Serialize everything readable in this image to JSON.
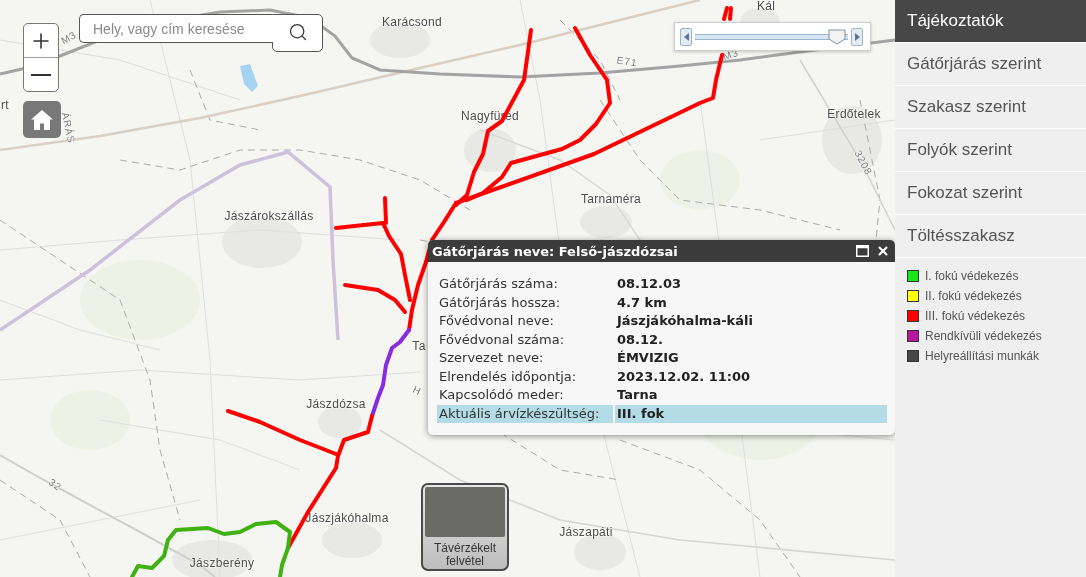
{
  "search": {
    "placeholder": "Hely, vagy cím keresése"
  },
  "time_slider": {
    "level": 0.93
  },
  "map_labels": [
    {
      "text": "Kál",
      "kind": "town"
    },
    {
      "text": "Karácsond",
      "kind": "town"
    },
    {
      "text": "M3",
      "kind": "road"
    },
    {
      "text": "M3",
      "kind": "road"
    },
    {
      "text": "E71",
      "kind": "road"
    },
    {
      "text": "rt",
      "kind": "town"
    },
    {
      "text": "Erdőtelek",
      "kind": "town"
    },
    {
      "text": "Nagyfüred",
      "kind": "town"
    },
    {
      "text": "ÁRÁS",
      "kind": "road"
    },
    {
      "text": "3208",
      "kind": "road"
    },
    {
      "text": "Tarnaméra",
      "kind": "town"
    },
    {
      "text": "Jászárokszállás",
      "kind": "town"
    },
    {
      "text": "Ta",
      "kind": "town"
    },
    {
      "text": "H",
      "kind": "road"
    },
    {
      "text": "Jászdózsa",
      "kind": "town"
    },
    {
      "text": "32",
      "kind": "road"
    },
    {
      "text": "Jászjákóhalma",
      "kind": "town"
    },
    {
      "text": "Jászapáti",
      "kind": "town"
    },
    {
      "text": "Jászberény",
      "kind": "town"
    }
  ],
  "imagery_button": {
    "label": "Távérzékelt felvétel"
  },
  "popup": {
    "title": "Gátőrjárás neve: Felső-jászdózsai",
    "rows": [
      {
        "label": "Gátőrjárás száma:",
        "value": "08.12.03",
        "highlighted": false
      },
      {
        "label": "Gátőrjárás hossza:",
        "value": "4.7 km",
        "highlighted": false
      },
      {
        "label": "Fővédvonal neve:",
        "value": "Jászjákóhalma-káli",
        "highlighted": false
      },
      {
        "label": "Fővédvonal száma:",
        "value": "08.12.",
        "highlighted": false
      },
      {
        "label": "Szervezet neve:",
        "value": "ÉMVIZIG",
        "highlighted": false
      },
      {
        "label": "Elrendelés időpontja:",
        "value": "2023.12.02. 11:00",
        "highlighted": false
      },
      {
        "label": "Kapcsolódó meder:",
        "value": "Tarna",
        "highlighted": false
      },
      {
        "label": "Aktuális árvízkészültség:",
        "value": "III. fok",
        "highlighted": true
      }
    ]
  },
  "sidebar": {
    "items": [
      {
        "label": "Tájékoztatók",
        "selected": true
      },
      {
        "label": "Gátőrjárás szerint",
        "selected": false
      },
      {
        "label": "Szakasz szerint",
        "selected": false
      },
      {
        "label": "Folyók szerint",
        "selected": false
      },
      {
        "label": "Fokozat szerint",
        "selected": false
      },
      {
        "label": "Töltésszakasz",
        "selected": false
      }
    ]
  },
  "legend": {
    "items": [
      {
        "label": "I. fokú védekezés",
        "color": "#19e619"
      },
      {
        "label": "II. fokú védekezés",
        "color": "#ffff00"
      },
      {
        "label": "III. fokú védekezés",
        "color": "#ff0000"
      },
      {
        "label": "Rendkívüli védekezés",
        "color": "#b5179e"
      },
      {
        "label": "Helyreállítási munkák",
        "color": "#474747"
      }
    ]
  }
}
